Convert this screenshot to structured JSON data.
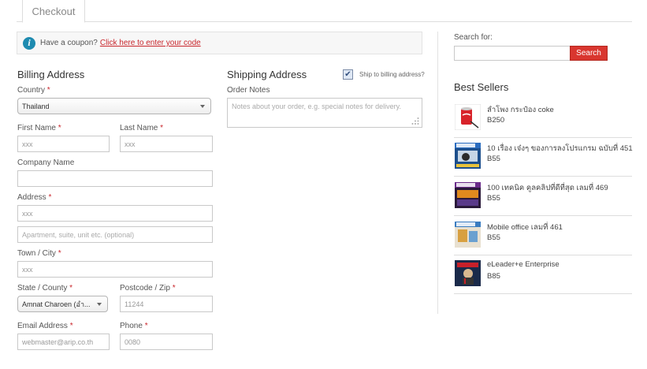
{
  "tabs": {
    "checkout": "Checkout"
  },
  "coupon": {
    "text": "Have a coupon?",
    "link": "Click here to enter your code"
  },
  "billing": {
    "title": "Billing Address",
    "country_label": "Country",
    "country_value": "Thailand",
    "first_name_label": "First Name",
    "first_name_value": "xxx",
    "last_name_label": "Last Name",
    "last_name_value": "xxx",
    "company_label": "Company Name",
    "address_label": "Address",
    "address_value": "xxx",
    "address2_placeholder": "Apartment, suite, unit etc. (optional)",
    "city_label": "Town / City",
    "city_value": "xxx",
    "state_label": "State / County",
    "state_value": "Amnat Charoen (อำ...",
    "postcode_label": "Postcode / Zip",
    "postcode_value": "11244",
    "email_label": "Email Address",
    "email_value": "webmaster@arip.co.th",
    "phone_label": "Phone",
    "phone_value": "0080",
    "required_mark": "*"
  },
  "shipping": {
    "title": "Shipping Address",
    "ship_to_billing": "Ship to billing address?",
    "ship_to_billing_checked": true,
    "order_notes_label": "Order Notes",
    "order_notes_placeholder": "Notes about your order, e.g. special notes for delivery."
  },
  "sidebar": {
    "search_label": "Search for:",
    "search_button": "Search",
    "best_sellers_title": "Best Sellers",
    "products": [
      {
        "name": "ลำโพง กระป๋อง coke",
        "price": "B250",
        "icon": "coke-can-speaker-thumbnail"
      },
      {
        "name": "10 เรื่อง เจ๋งๆ ของการลงโปรแกรม ฉบับที่ 451",
        "price": "B55",
        "icon": "magazine-cover-thumbnail"
      },
      {
        "name": "100 เทคนิค คูลคลิปที่ดีที่สุด เลมที่ 469",
        "price": "B55",
        "icon": "magazine-cover-thumbnail"
      },
      {
        "name": "Mobile office เลมที่ 461",
        "price": "B55",
        "icon": "magazine-cover-thumbnail"
      },
      {
        "name": "eLeader+e Enterprise",
        "price": "B85",
        "icon": "book-cover-thumbnail"
      }
    ]
  },
  "colors": {
    "accent": "#d9362f",
    "link": "#c9262c",
    "info": "#1e8bb0"
  }
}
